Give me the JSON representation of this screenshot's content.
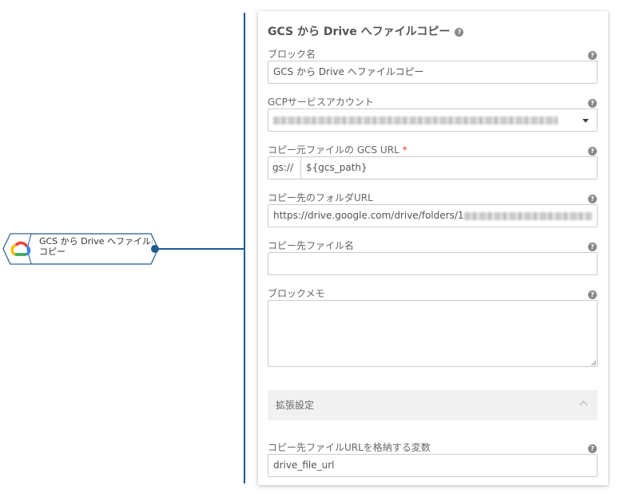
{
  "node": {
    "label": "GCS から Drive へファイルコピー",
    "icon": "google-cloud-icon"
  },
  "panel": {
    "title": "GCS から Drive へファイルコピー",
    "block_name": {
      "label": "ブロック名",
      "value": "GCS から Drive へファイルコピー"
    },
    "gcp_account": {
      "label": "GCPサービスアカウント"
    },
    "gcs_url": {
      "label": "コピー元ファイルの GCS URL",
      "required_mark": "*",
      "prefix": "gs://",
      "value": "${gcs_path}"
    },
    "folder_url": {
      "label": "コピー先のフォルダURL",
      "value": "https://drive.google.com/drive/folders/1"
    },
    "file_name": {
      "label": "コピー先ファイル名",
      "value": ""
    },
    "memo": {
      "label": "ブロックメモ",
      "value": ""
    },
    "advanced": {
      "label": "拡張設定"
    },
    "url_variable": {
      "label": "コピー先ファイルURLを格納する変数",
      "value": "drive_file_url"
    }
  },
  "help_glyph": "?",
  "colors": {
    "accent": "#1f5b8f",
    "required": "#e0442d"
  }
}
